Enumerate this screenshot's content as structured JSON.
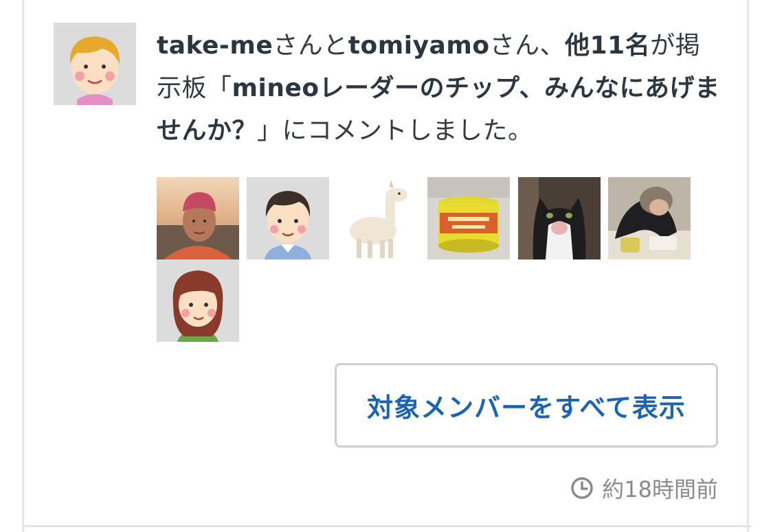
{
  "notification": {
    "user1": "take-me",
    "honorific1": "さんと",
    "user2": "tomiyamo",
    "honorific2": "さん、",
    "others": "他11名",
    "verb_pre": "が掲示板「",
    "board_title": "mineoレーダーのチップ、みんなにあげませんか？",
    "verb_post": "」にコメントしました。"
  },
  "actor_avatar_icon": "boy-avatar-icon",
  "member_thumbnails": [
    {
      "icon": "photo-man-with-hat-icon"
    },
    {
      "icon": "illustrated-man-avatar-icon"
    },
    {
      "icon": "alpaca-toy-photo-icon"
    },
    {
      "icon": "yellow-jar-photo-icon"
    },
    {
      "icon": "cat-photo-icon"
    },
    {
      "icon": "person-desk-photo-icon"
    },
    {
      "icon": "illustrated-woman-avatar-icon"
    }
  ],
  "show_all_button": "対象メンバーをすべて表示",
  "timestamp": "約18時間前",
  "colors": {
    "text": "#333b42",
    "link": "#1d64b0",
    "muted": "#8a8a8a",
    "border": "#cfcfcf"
  }
}
